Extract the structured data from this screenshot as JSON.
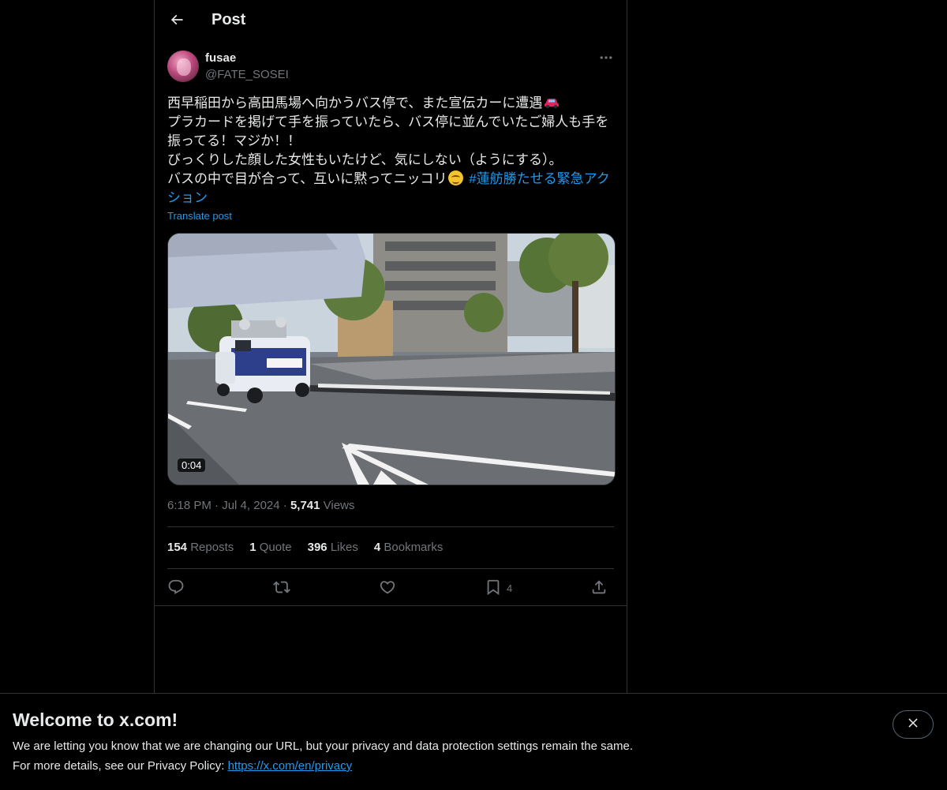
{
  "header": {
    "title": "Post"
  },
  "author": {
    "name": "fusae",
    "handle": "@FATE_SOSEI"
  },
  "tweet": {
    "text_lines": [
      "西早稲田から高田馬場へ向かうバス停で、また宣伝カーに遭遇",
      "プラカードを掲げて手を振っていたら、バス停に並んでいたご婦人も手を",
      "振ってる！マジか！！",
      "びっくりした顔した女性もいたけど、気にしない（ようにする）。",
      "バスの中で目が合って、互いに黙ってニッコリ"
    ],
    "hashtag": "#蓮舫勝たせる緊急アク",
    "hashtag_cont": "ション",
    "translate_label": "Translate post",
    "video_duration": "0:04"
  },
  "meta": {
    "time": "6:18 PM",
    "date": "Jul 4, 2024",
    "views_count": "5,741",
    "views_label": "Views"
  },
  "stats": {
    "reposts_count": "154",
    "reposts_label": "Reposts",
    "quotes_count": "1",
    "quotes_label": "Quote",
    "likes_count": "396",
    "likes_label": "Likes",
    "bookmarks_count": "4",
    "bookmarks_label": "Bookmarks"
  },
  "actions": {
    "icons": [
      "reply-icon",
      "repost-icon",
      "like-icon",
      "bookmark-icon",
      "share-icon"
    ],
    "bookmark_count": "4"
  },
  "banner": {
    "title": "Welcome to x.com!",
    "line1": "We are letting you know that we are changing our URL, but your privacy and data protection settings remain the same.",
    "line2_prefix": "For more details, see our Privacy Policy: ",
    "link": "https://x.com/en/privacy"
  },
  "colors": {
    "accent": "#1d9bf0",
    "text": "#e7e9ea",
    "muted": "#71767b",
    "border": "#2f3336"
  }
}
